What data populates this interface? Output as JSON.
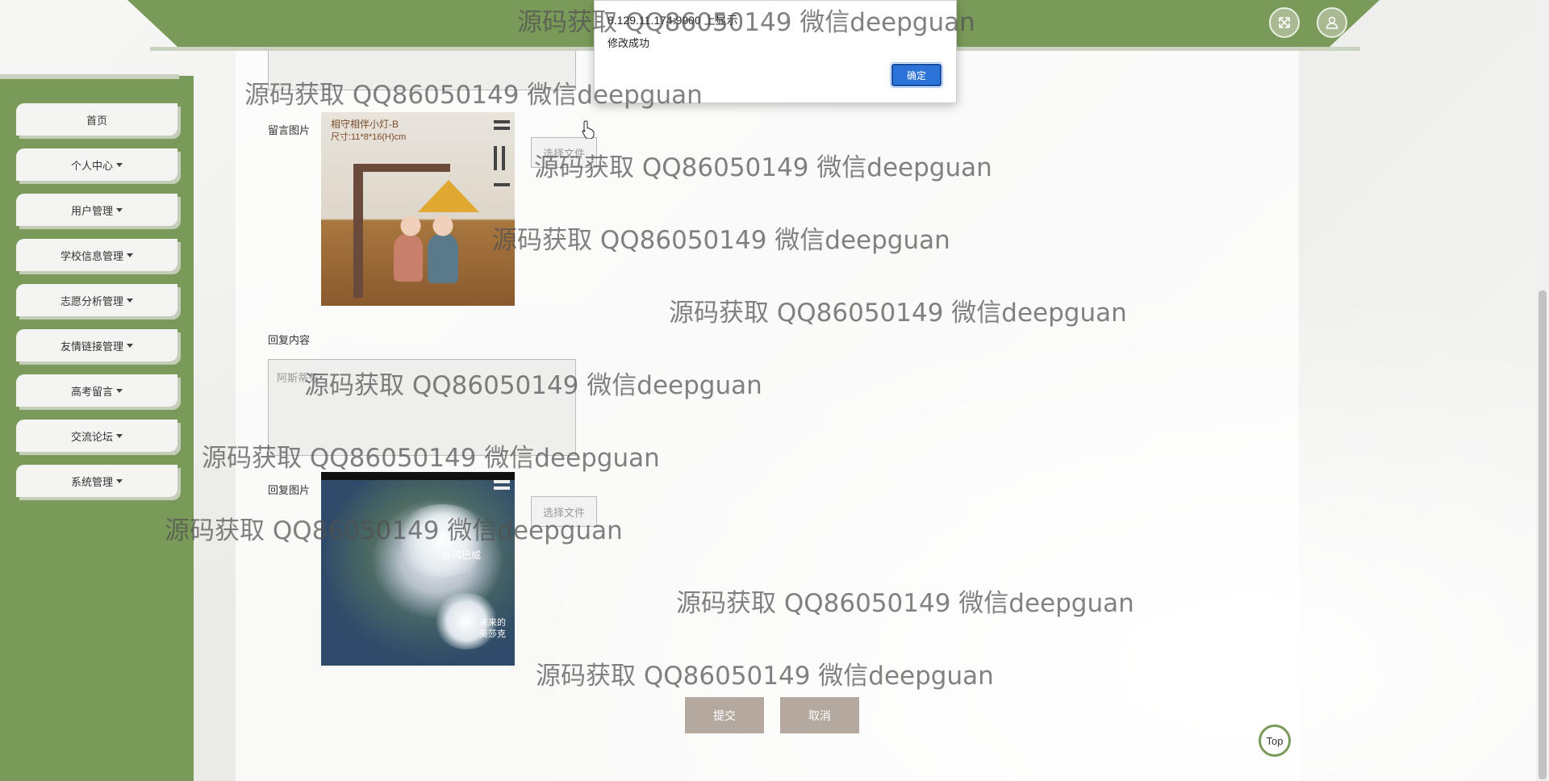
{
  "header": {
    "fullscreen_icon": "fullscreen-icon",
    "user_icon": "user-icon"
  },
  "sidebar": {
    "items": [
      {
        "label": "首页",
        "dropdown": false
      },
      {
        "label": "个人中心",
        "dropdown": true
      },
      {
        "label": "用户管理",
        "dropdown": true
      },
      {
        "label": "学校信息管理",
        "dropdown": true
      },
      {
        "label": "志愿分析管理",
        "dropdown": true
      },
      {
        "label": "友情链接管理",
        "dropdown": true
      },
      {
        "label": "高考留言",
        "dropdown": true
      },
      {
        "label": "交流论坛",
        "dropdown": true
      },
      {
        "label": "系统管理",
        "dropdown": true
      }
    ]
  },
  "form": {
    "message_image_label": "留言图片",
    "message_image_caption_line1": "相守相伴小灯-B",
    "message_image_caption_line2": "尺寸:11*8*16(H)cm",
    "choose_file_label": "选择文件",
    "reply_content_label": "回复内容",
    "reply_content_value": "阿斯蒂芬",
    "reply_image_label": "回复图片",
    "reply_image_caption": "台风巴威",
    "reply_image_caption2": "未来的美莎克",
    "submit_label": "提交",
    "cancel_label": "取消"
  },
  "dialog": {
    "title": "8.129.11.174:9000 上显示",
    "message": "修改成功",
    "ok_label": "确定"
  },
  "back_to_top_label": "Top",
  "watermark_text": "源码获取 QQ86050149 微信deepguan",
  "colors": {
    "brand_green": "#7a9a5a",
    "button_tan": "#b5a99f",
    "dialog_blue": "#2b73d8"
  }
}
